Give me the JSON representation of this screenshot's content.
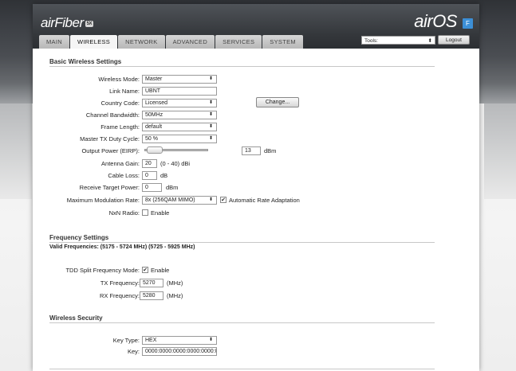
{
  "header": {
    "logo": "airFiber",
    "logo_badge": "5X",
    "airos_brand": "airOS",
    "airos_icon": "F",
    "tabs": [
      "MAIN",
      "WIRELESS",
      "NETWORK",
      "ADVANCED",
      "SERVICES",
      "SYSTEM"
    ],
    "active_tab": "WIRELESS",
    "tools_label": "Tools:",
    "logout_label": "Logout"
  },
  "basic": {
    "title": "Basic Wireless Settings",
    "wireless_mode": {
      "label": "Wireless Mode:",
      "value": "Master"
    },
    "link_name": {
      "label": "Link Name:",
      "value": "UBNT"
    },
    "country_code": {
      "label": "Country Code:",
      "value": "Licensed",
      "button": "Change..."
    },
    "channel_bandwidth": {
      "label": "Channel Bandwidth:",
      "value": "50MHz"
    },
    "frame_length": {
      "label": "Frame Length:",
      "value": "default"
    },
    "duty_cycle": {
      "label": "Master TX Duty Cycle:",
      "value": "50 %"
    },
    "output_power": {
      "label": "Output Power (EIRP):",
      "value": "13",
      "unit": "dBm",
      "slider_level": 0.05
    },
    "antenna_gain": {
      "label": "Antenna Gain:",
      "value": "20",
      "unit": "(0 - 40) dBi"
    },
    "cable_loss": {
      "label": "Cable Loss:",
      "value": "0",
      "unit": "dB"
    },
    "receive_target": {
      "label": "Receive Target Power:",
      "value": "0",
      "unit": "dBm"
    },
    "modulation": {
      "label": "Maximum Modulation Rate:",
      "value": "8x (256QAM MIMO)",
      "adaptation_label": "Automatic Rate Adaptation",
      "adaptation_checked": true
    },
    "nxn_radio": {
      "label": "NxN Radio:",
      "enable_label": "Enable",
      "checked": false
    }
  },
  "frequency": {
    "title": "Frequency Settings",
    "valid": "Valid Frequencies: (5175 - 5724 MHz) (5725 - 5925 MHz)",
    "tdd": {
      "label": "TDD Split Frequency Mode:",
      "enable_label": "Enable",
      "checked": true
    },
    "tx": {
      "label": "TX Frequency:",
      "value": "5270",
      "unit": "(MHz)"
    },
    "rx": {
      "label": "RX Frequency:",
      "value": "5280",
      "unit": "(MHz)"
    }
  },
  "security": {
    "title": "Wireless Security",
    "key_type": {
      "label": "Key Type:",
      "value": "HEX"
    },
    "key": {
      "label": "Key:",
      "value": "0000:0000:0000:0000:0000:0"
    }
  }
}
